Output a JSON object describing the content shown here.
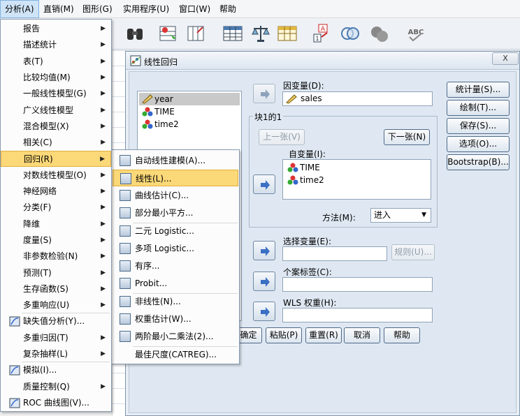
{
  "menubar": {
    "items": [
      "分析(A)",
      "直销(M)",
      "图形(G)",
      "实用程序(U)",
      "窗口(W)",
      "帮助"
    ]
  },
  "main_menu": {
    "items": [
      {
        "label": "报告",
        "arrow": true
      },
      {
        "label": "描述统计",
        "arrow": true
      },
      {
        "label": "表(T)",
        "arrow": true
      },
      {
        "label": "比较均值(M)",
        "arrow": true
      },
      {
        "label": "一般线性模型(G)",
        "arrow": true
      },
      {
        "label": "广义线性模型",
        "arrow": true
      },
      {
        "label": "混合模型(X)",
        "arrow": true
      },
      {
        "label": "相关(C)",
        "arrow": true
      },
      {
        "label": "回归(R)",
        "arrow": true
      },
      {
        "label": "对数线性模型(O)",
        "arrow": true
      },
      {
        "label": "神经网络",
        "arrow": true
      },
      {
        "label": "分类(F)",
        "arrow": true
      },
      {
        "label": "降维",
        "arrow": true
      },
      {
        "label": "度量(S)",
        "arrow": true
      },
      {
        "label": "非参数检验(N)",
        "arrow": true
      },
      {
        "label": "预测(T)",
        "arrow": true
      },
      {
        "label": "生存函数(S)",
        "arrow": true
      },
      {
        "label": "多重响应(U)",
        "arrow": true
      },
      {
        "label": "缺失值分析(Y)...",
        "arrow": false
      },
      {
        "label": "多重归因(T)",
        "arrow": true
      },
      {
        "label": "复杂抽样(L)",
        "arrow": true
      },
      {
        "label": "模拟(I)...",
        "arrow": false
      },
      {
        "label": "质量控制(Q)",
        "arrow": true
      },
      {
        "label": "ROC 曲线图(V)...",
        "arrow": false
      }
    ],
    "arrow_glyph": "▶"
  },
  "sub_menu": {
    "items": [
      "自动线性建模(A)...",
      "线性(L)...",
      "曲线估计(C)...",
      "部分最小平方...",
      "二元 Logistic...",
      "多项 Logistic...",
      "有序...",
      "Probit...",
      "非线性(N)...",
      "权重估计(W)...",
      "两阶最小二乘法(2)...",
      "最佳尺度(CATREG)..."
    ]
  },
  "dialog": {
    "title": "线性回归",
    "close": "X",
    "variables": [
      "year",
      "TIME",
      "time2"
    ],
    "dependent_label": "因变量(D):",
    "dependent_value": "sales",
    "block_label": "块1的1",
    "prev_button": "上一张(V)",
    "next_button": "下一张(N)",
    "independent_label": "自变量(I):",
    "independent_values": [
      "TIME",
      "time2"
    ],
    "method_label": "方法(M):",
    "method_value": "进入",
    "selection_label": "选择变量(E):",
    "rule_button": "规则(U)...",
    "case_label": "个案标签(C):",
    "wls_label": "WLS 权重(H):",
    "side_buttons": [
      "统计量(S)...",
      "绘制(T)...",
      "保存(S)...",
      "选项(O)...",
      "Bootstrap(B)..."
    ],
    "bottom_buttons": [
      "确定",
      "粘贴(P)",
      "重置(R)",
      "取消",
      "帮助"
    ]
  },
  "colors": {
    "highlight": "#fbd878",
    "menu_active": "#cfe4f7",
    "dialog_bg": "#dfe8f2"
  }
}
